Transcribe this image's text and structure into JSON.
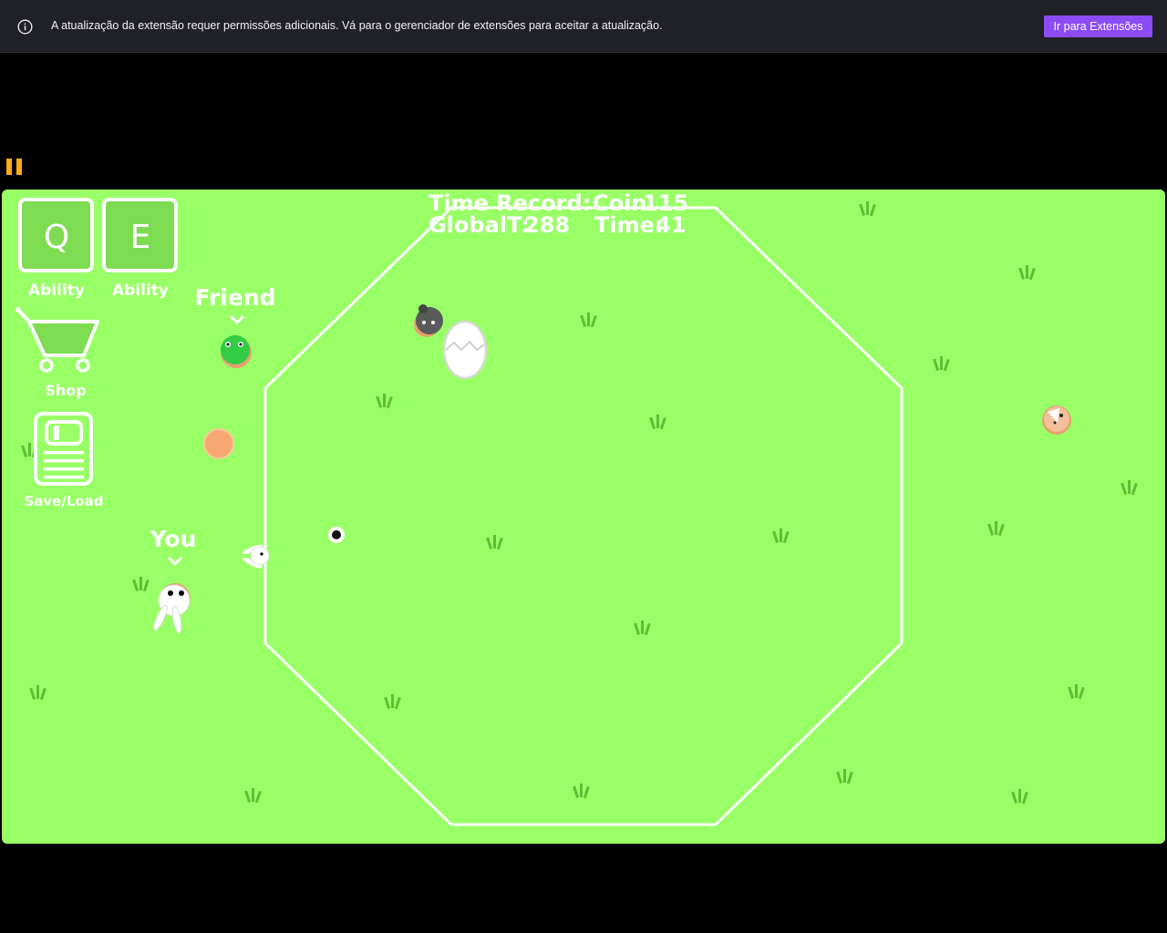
{
  "notification": {
    "message": "A atualização da extensão requer permissões adicionais. Vá para o gerenciador de extensões para aceitar a atualização.",
    "button_label": "Ir para Extensões",
    "icon": "info-icon"
  },
  "player_controls": {
    "pause_icon": "pause-icon",
    "pause_color": "#ffab19"
  },
  "game": {
    "background_color": "#99ff66",
    "hud": {
      "time_record_label": "Time Record:",
      "coin_label": "Coin:",
      "coin_value": "115",
      "global_label": "GlobalT:",
      "global_value": "288",
      "time_label": "Time:",
      "time_value": "41"
    },
    "abilities": [
      {
        "key": "Q",
        "label": "Ability"
      },
      {
        "key": "E",
        "label": "Ability"
      }
    ],
    "shop_label": "Shop",
    "save_load_label": "Save/Load",
    "friend_label": "Friend",
    "you_label": "You"
  }
}
